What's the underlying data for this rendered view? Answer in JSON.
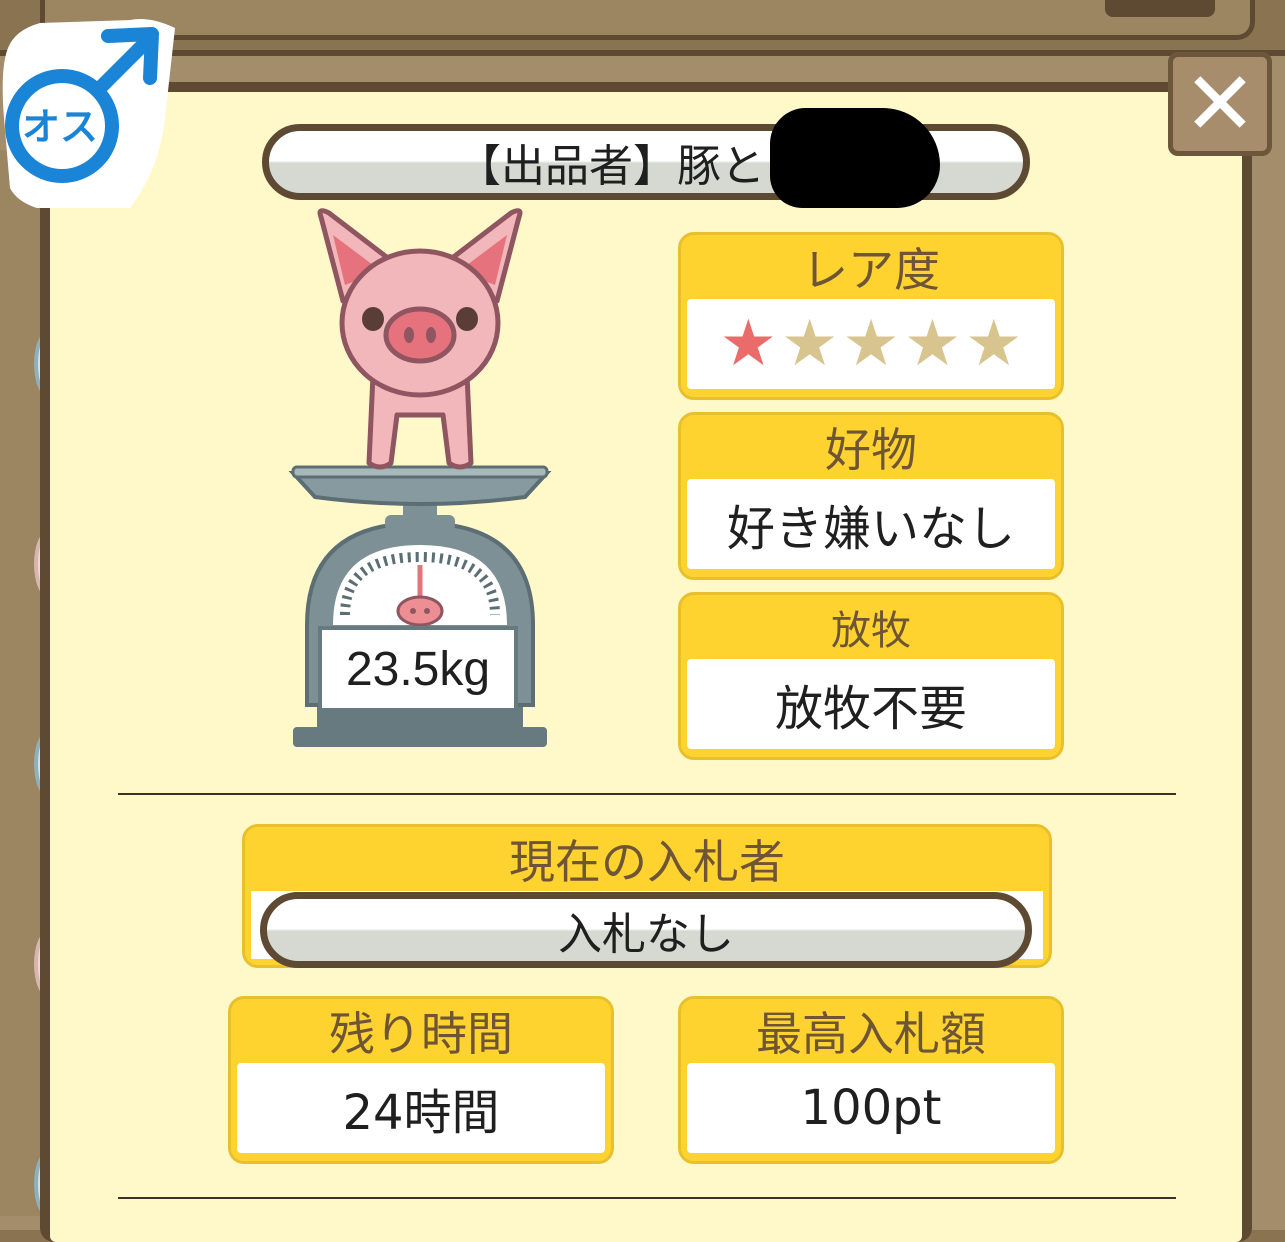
{
  "gender": {
    "label": "オス",
    "color": "#1a84d6"
  },
  "close_button": {
    "label": "✕"
  },
  "seller": {
    "label": "【出品者】豚と"
  },
  "pig": {
    "weight": "23.5kg"
  },
  "rarity": {
    "title": "レア度",
    "stars_filled": 1,
    "stars_total": 5,
    "star_glyph": "★"
  },
  "likes": {
    "title": "好物",
    "value": "好き嫌いなし"
  },
  "grazing": {
    "title": "放牧",
    "value": "放牧不要"
  },
  "current_bidder": {
    "title": "現在の入札者",
    "value": "入札なし"
  },
  "remaining_time": {
    "title": "残り時間",
    "value": "24時間"
  },
  "highest_bid": {
    "title": "最高入札額",
    "value": "100pt"
  },
  "colors": {
    "header_yellow": "#ffd32f",
    "panel_cream": "#fff9c9",
    "wood": "#5e4a33",
    "star_on": "#e96c6a",
    "star_off": "#d7c48e"
  }
}
